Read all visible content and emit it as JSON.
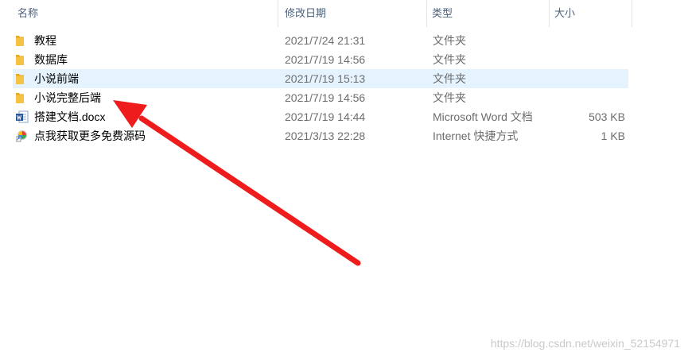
{
  "columns": {
    "name": "名称",
    "modified": "修改日期",
    "type": "类型",
    "size": "大小"
  },
  "files": [
    {
      "name": "教程",
      "date": "2021/7/24 21:31",
      "type": "文件夹",
      "size": "",
      "icon": "folder-icon",
      "selected": false
    },
    {
      "name": "数据库",
      "date": "2021/7/19 14:56",
      "type": "文件夹",
      "size": "",
      "icon": "folder-icon",
      "selected": false
    },
    {
      "name": "小说前端",
      "date": "2021/7/19 15:13",
      "type": "文件夹",
      "size": "",
      "icon": "folder-icon",
      "selected": true
    },
    {
      "name": "小说完整后端",
      "date": "2021/7/19 14:56",
      "type": "文件夹",
      "size": "",
      "icon": "folder-icon",
      "selected": false
    },
    {
      "name": "搭建文档.docx",
      "date": "2021/7/19 14:44",
      "type": "Microsoft Word 文档",
      "size": "503 KB",
      "icon": "word-document-icon",
      "selected": false
    },
    {
      "name": "点我获取更多免费源码",
      "date": "2021/3/13 22:28",
      "type": "Internet 快捷方式",
      "size": "1 KB",
      "icon": "internet-shortcut-icon",
      "selected": false
    }
  ],
  "watermark": "https://blog.csdn.net/weixin_52154971",
  "colors": {
    "selection": "#e5f3ff",
    "folder": "#f5c343",
    "arrow": "#ee1c1c",
    "word": "#2b5797"
  }
}
